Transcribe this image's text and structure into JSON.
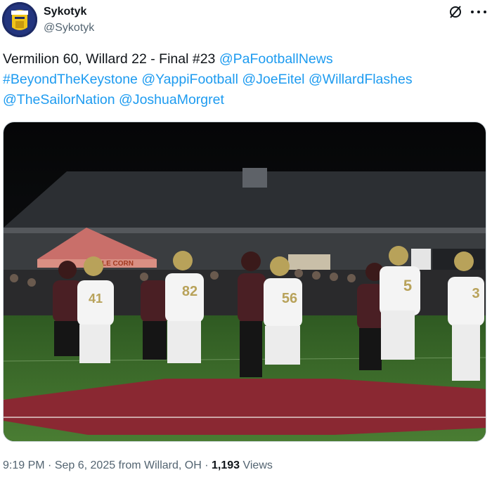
{
  "author": {
    "display_name": "Sykotyk",
    "handle": "@Sykotyk"
  },
  "header_icons": [
    "grok-icon",
    "more-icon"
  ],
  "tweet": {
    "text_plain": "Vermilion 60, Willard 22 - Final #23 ",
    "mentions": [
      "@PaFootballNews",
      "#BeyondTheKeystone",
      "@YappiFootball",
      "@JoeEitel",
      "@WillardFlashes",
      "@TheSailorNation",
      "@JoshuaMorgret"
    ]
  },
  "media": {
    "jersey_numbers": [
      "41",
      "82",
      "56",
      "5",
      "3"
    ],
    "sign_text": "LE CORN",
    "colors": {
      "field_green": "#3e6e2c",
      "endzone_maroon": "#8a2832",
      "home_jersey": "#4a1f24",
      "away_jersey": "#f4f4f4",
      "helmet_gold": "#b8a25a"
    }
  },
  "meta": {
    "time": "9:19 PM",
    "separator1": " · ",
    "date": "Sep 6, 2025 from Willard, OH",
    "separator2": " · ",
    "views_count": "1,193",
    "views_label": " Views"
  }
}
